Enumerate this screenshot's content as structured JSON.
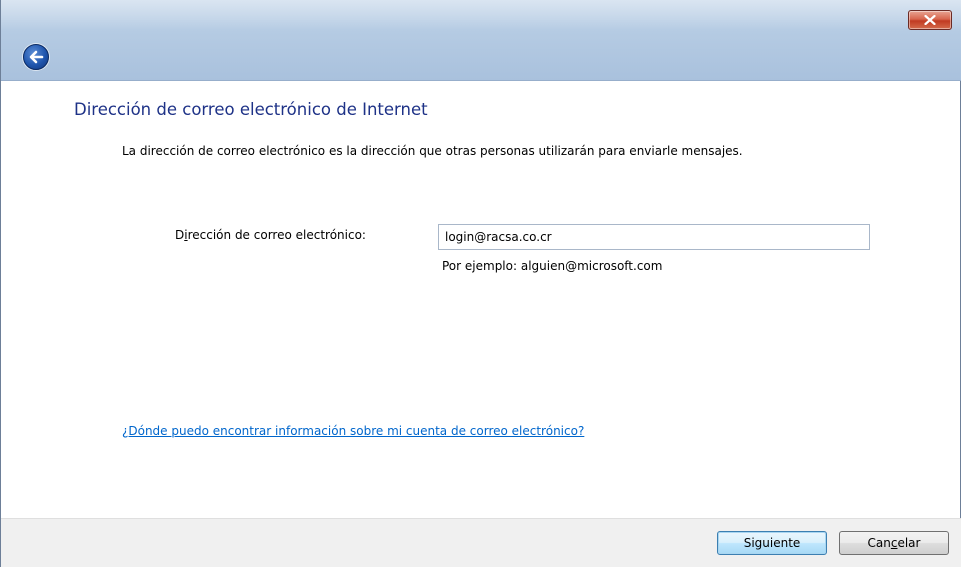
{
  "window": {
    "close_label": "close",
    "back_label": "back"
  },
  "main": {
    "heading": "Dirección de correo electrónico de Internet",
    "description": "La dirección de correo electrónico es la dirección que otras personas utilizarán para enviarle mensajes.",
    "email_label_prefix": "D",
    "email_label_accesskey": "i",
    "email_label_rest": "rección de correo electrónico:",
    "email_value": "login@racsa.co.cr",
    "example": "Por ejemplo: alguien@microsoft.com",
    "help_link": "¿Dónde puedo encontrar información sobre mi cuenta de correo electrónico?"
  },
  "footer": {
    "next_label": "Siguiente",
    "cancel_prefix": "Can",
    "cancel_accesskey": "c",
    "cancel_rest": "elar"
  },
  "colors": {
    "heading": "#1e3287",
    "link": "#0066cc",
    "titlebar": "#b5cbe3",
    "close": "#c13b22",
    "footer": "#f0f0f0"
  }
}
